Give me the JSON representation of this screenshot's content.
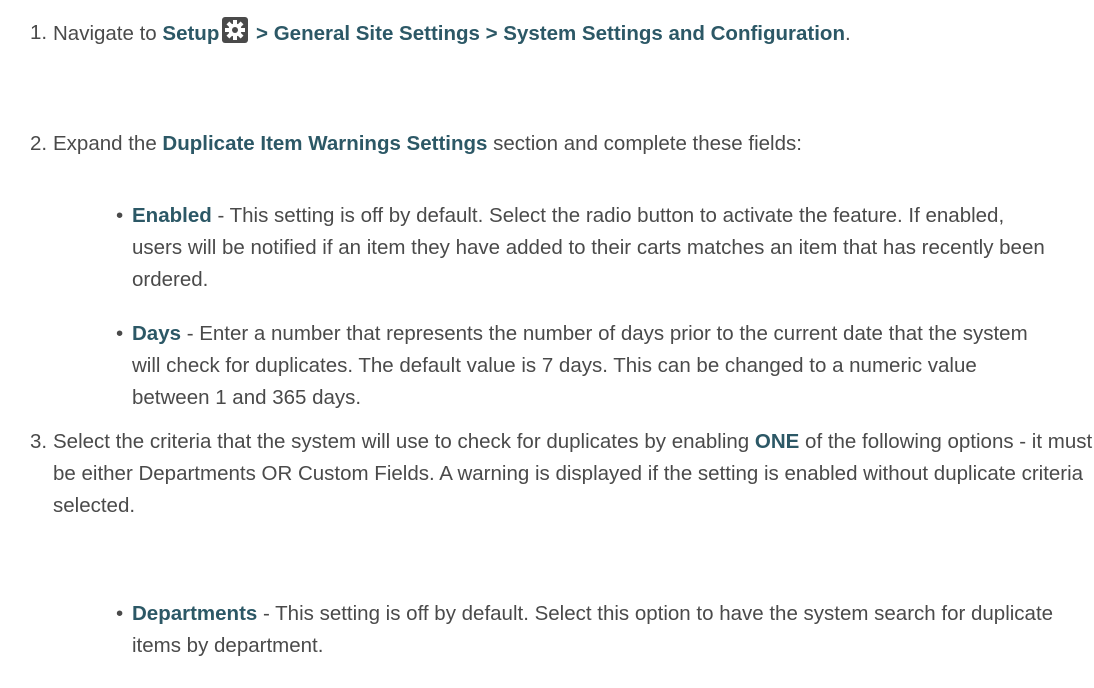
{
  "steps": [
    {
      "number": "1.",
      "prefix": "Navigate to ",
      "setup": "Setup",
      "path": " > General Site Settings > System Settings and Configuration",
      "suffix": "."
    },
    {
      "number": "2.",
      "prefix": "Expand the ",
      "section": "Duplicate Item Warnings Settings",
      "suffix": " section and complete these fields:",
      "bullets": [
        {
          "term": "Enabled",
          "text": " - This setting is off by default. Select the radio button to activate the feature. If enabled, users will be notified if an item they have added to their carts matches an item that has recently been ordered."
        },
        {
          "term": "Days",
          "text": " - Enter a number that represents the number of days prior to the current date that the system will check for duplicates. The default value is 7 days. This can be changed to a numeric value between 1 and 365 days."
        }
      ]
    },
    {
      "number": "3.",
      "prefix": "Select the criteria that the system will use to check for duplicates by enabling ",
      "emphasis": "ONE",
      "suffix": " of the following options - it must be either Departments OR Custom Fields. A warning is displayed if the setting is enabled without duplicate criteria selected.",
      "bullets": [
        {
          "term": "Departments",
          "text": " - This setting is off by default. Select this option to have the system search for duplicate items by department."
        }
      ]
    }
  ],
  "bullet_glyph": "•",
  "icons": {
    "setup": "gear-icon"
  },
  "colors": {
    "text": "#4a4a4a",
    "highlight": "#2c5866",
    "icon_bg": "#4a4a4a"
  }
}
